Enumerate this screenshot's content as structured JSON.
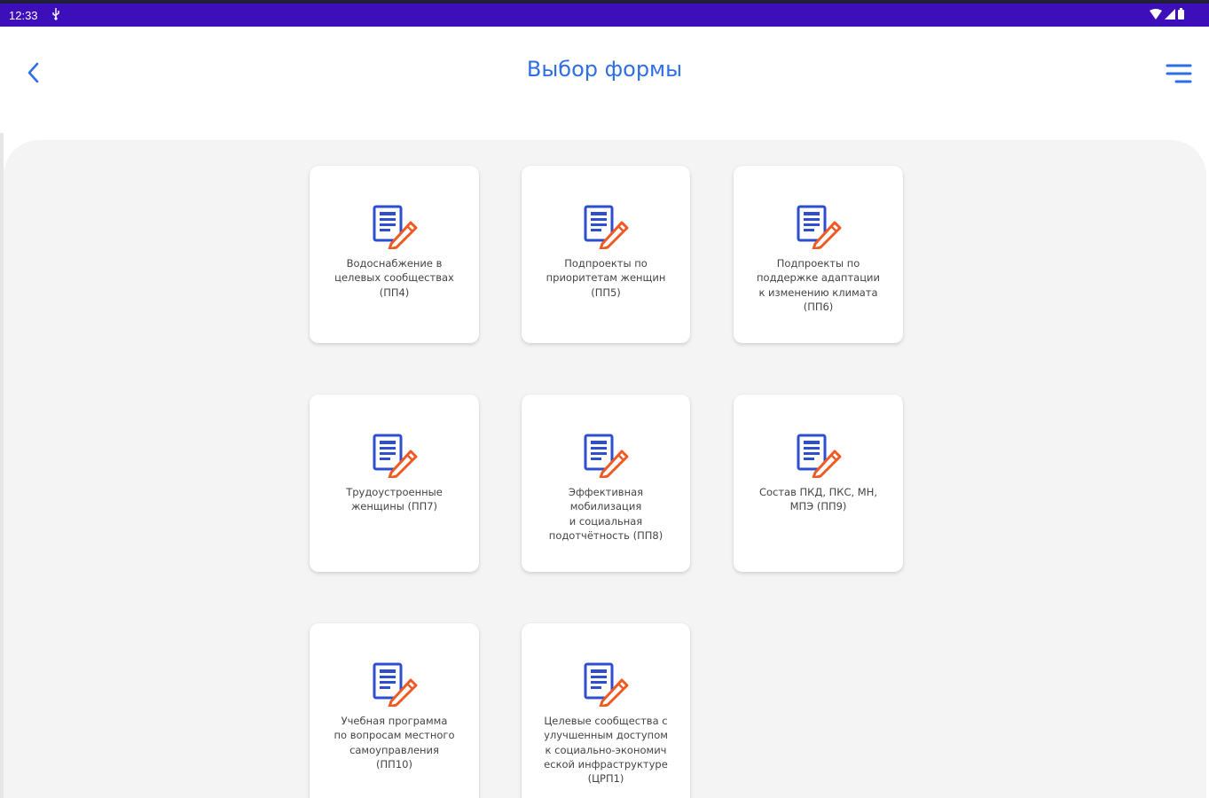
{
  "status_bar": {
    "time": "12:33",
    "usb_icon": "usb-icon",
    "wifi_icon": "wifi-icon",
    "signal_icon": "signal-icon",
    "battery_icon": "battery-icon",
    "background_color": "#3d0fba"
  },
  "header": {
    "title": "Выбор формы",
    "back_icon": "chevron-left-icon",
    "menu_icon": "hamburger-menu-icon",
    "accent_color": "#2f6fe6"
  },
  "forms": [
    {
      "label": "Водоснабжение в\nцелевых сообществах\n(ПП4)",
      "icon": "form-edit-icon"
    },
    {
      "label": "Подпроекты по\nприоритетам женщин\n(ПП5)",
      "icon": "form-edit-icon"
    },
    {
      "label": "Подпроекты по\nподдержке адаптации\nк изменению климата\n(ПП6)",
      "icon": "form-edit-icon"
    },
    {
      "label": "Трудоустроенные\nженщины (ПП7)",
      "icon": "form-edit-icon"
    },
    {
      "label": "Эффективная\nмобилизация\nи социальная\nподотчётность (ПП8)",
      "icon": "form-edit-icon"
    },
    {
      "label": "Состав ПКД, ПКС, МН,\nМПЭ (ПП9)",
      "icon": "form-edit-icon"
    },
    {
      "label": "Учебная программа\nпо вопросам местного\nсамоуправления\n(ПП10)",
      "icon": "form-edit-icon"
    },
    {
      "label": "Целевые сообщества с\nулучшенным доступом\nк социально-экономич\nеской инфраструктуре\n(ЦРП1)",
      "icon": "form-edit-icon"
    }
  ],
  "colors": {
    "icon_blue": "#2d4fcf",
    "icon_orange": "#f05a22",
    "content_background": "#f4f4f5"
  }
}
